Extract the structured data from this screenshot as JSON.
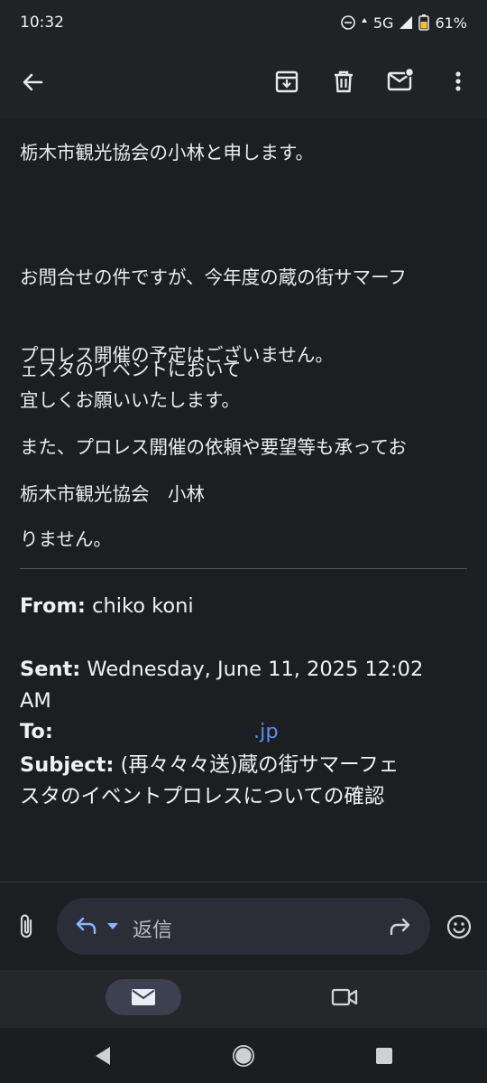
{
  "status": {
    "time": "10:32",
    "network": "5G",
    "battery": "61%"
  },
  "toolbar": {
    "back_icon": "arrow-left-icon",
    "archive_icon": "archive-icon",
    "delete_icon": "trash-icon",
    "unread_icon": "mark-unread-icon",
    "more_icon": "more-vertical-icon"
  },
  "email": {
    "greeting": "栃木市観光協会の小林と申します。",
    "para1_line1": "お問合せの件ですが、今年度の蔵の街サマーフ",
    "para1_line2": "ェスタのイベントにおいて",
    "para2_line1": "プロレス開催の予定はございません。",
    "para2_line2": "また、プロレス開催の依頼や要望等も承ってお",
    "para2_line3": "りません。",
    "closing": "宜しくお願いいたします。",
    "signature": "栃木市観光協会　小林"
  },
  "quoted": {
    "from_label": "From:",
    "from_value": " chiko koni",
    "sent_label": "Sent:",
    "sent_value_line1": " Wednesday, June 11, 2025 12:02",
    "sent_value_line2": "AM",
    "to_label": "To:",
    "to_value": ".jp",
    "subject_label": "Subject:",
    "subject_line1": " (再々々々送)蔵の街サマーフェ",
    "subject_line2": "スタのイベントプロレスについての確認"
  },
  "reply": {
    "placeholder": "返信",
    "attach_icon": "paperclip-icon",
    "reply_icon": "reply-icon",
    "dropdown_icon": "chevron-down-icon",
    "forward_icon": "forward-icon",
    "emoji_icon": "emoji-icon"
  },
  "nav": {
    "mail_icon": "mail-icon",
    "meet_icon": "video-icon"
  }
}
